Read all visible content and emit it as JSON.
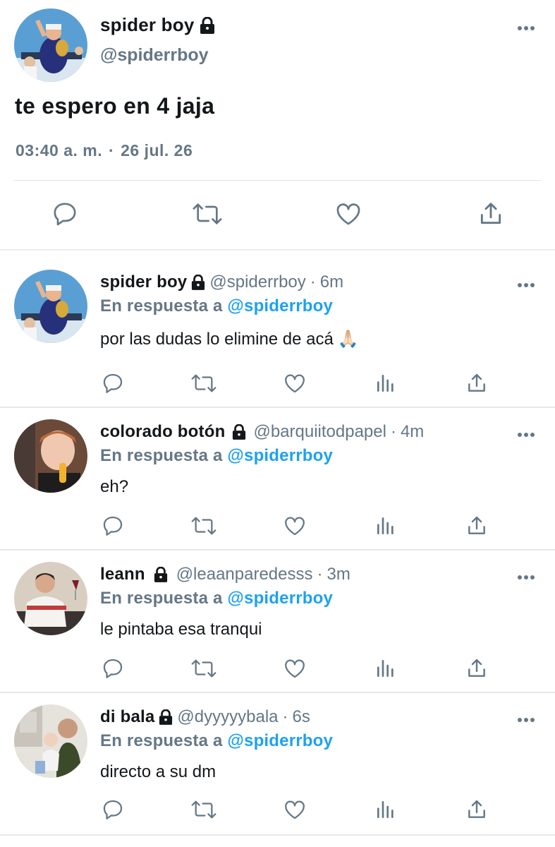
{
  "main_tweet": {
    "display_name": "spider boy",
    "handle": "@spiderrboy",
    "text": "te espero en 4 jaja",
    "time": "03:40 a. m.",
    "separator": "·",
    "date": "26 jul. 26",
    "actions": [
      "reply-icon",
      "retweet-icon",
      "like-icon",
      "share-icon"
    ]
  },
  "replies": [
    {
      "display_name": "spider boy",
      "handle": "@spiderrboy",
      "dot": "·",
      "time": "6m",
      "in_reply_prefix": "En respuesta a",
      "in_reply_to": "@spiderrboy",
      "text": "por las dudas lo elimine de acá",
      "emoji": "🙏🏻"
    },
    {
      "display_name": "colorado botón",
      "handle": "@barquiitodpapel",
      "dot": "·",
      "time": "4m",
      "in_reply_prefix": "En respuesta a",
      "in_reply_to": "@spiderrboy",
      "text": "eh?"
    },
    {
      "display_name": "leann",
      "handle": "@leaanparedesss",
      "dot": "·",
      "time": "3m",
      "in_reply_prefix": "En respuesta a",
      "in_reply_to": "@spiderrboy",
      "text": "le pintaba esa tranqui"
    },
    {
      "display_name": "di bala",
      "handle": "@dyyyyybala",
      "dot": "·",
      "time": "6s",
      "in_reply_prefix": "En respuesta a",
      "in_reply_to": "@spiderrboy",
      "text": "directo a su dm"
    }
  ],
  "reply_actions": [
    "reply-icon",
    "retweet-icon",
    "like-icon",
    "analytics-icon",
    "share-icon"
  ],
  "colors": {
    "text": "#14171a",
    "secondary": "#657786",
    "link": "#1da1f2",
    "divider": "#e6e9eb"
  }
}
